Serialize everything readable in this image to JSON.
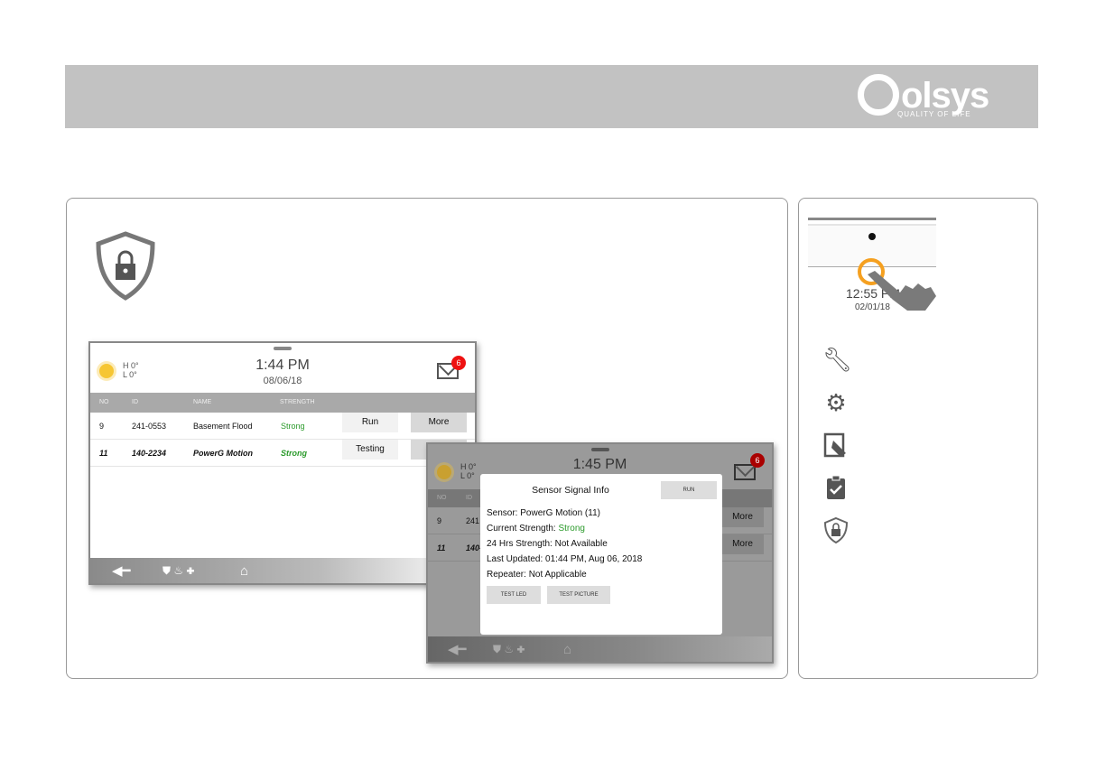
{
  "brand": {
    "name": "olsys",
    "tagline": "QUALITY OF LIFE"
  },
  "screen1": {
    "weather": {
      "icon": "sun-icon",
      "high": "H 0°",
      "low": "L 0°"
    },
    "time": "1:44 PM",
    "date": "08/06/18",
    "messages_count": "6",
    "columns": [
      "NO",
      "ID",
      "NAME",
      "STRENGTH"
    ],
    "rows": [
      {
        "no": "9",
        "id": "241-0553",
        "name": "Basement Flood",
        "strength": "Strong",
        "action": "Run",
        "more": "More"
      },
      {
        "no": "11",
        "id": "140-2234",
        "name": "PowerG Motion",
        "strength": "Strong",
        "action": "Testing",
        "more": "More"
      }
    ]
  },
  "screen2": {
    "weather": {
      "high": "H 0°",
      "low": "L 0°"
    },
    "time": "1:45 PM",
    "messages_count": "6",
    "columns": [
      "NO",
      "ID"
    ],
    "rows": [
      {
        "no": "9",
        "id": "241",
        "more": "More"
      },
      {
        "no": "11",
        "id": "140-",
        "more": "More"
      }
    ],
    "modal": {
      "title": "Sensor Signal Info",
      "run": "RUN",
      "sensor": "Sensor: PowerG Motion (11)",
      "current_label": "Current Strength: ",
      "current_value": "Strong",
      "hrs24": "24 Hrs Strength: Not Available",
      "last_updated": "Last Updated: 01:44 PM, Aug 06, 2018",
      "repeater": "Repeater: Not Applicable",
      "test_led": "TEST LED",
      "test_picture": "TEST PICTURE"
    }
  },
  "sidebar": {
    "time": "12:55 PM",
    "date": "02/01/18",
    "icons": [
      "wrench-icon",
      "gear-icon",
      "installation-hand-icon",
      "clipboard-check-icon",
      "shield-lock-icon"
    ]
  },
  "colors": {
    "accent_orange": "#f5a020",
    "strong_green": "#2a9a2a",
    "badge_red": "#e11111",
    "header_gray": "#c2c2c2"
  }
}
